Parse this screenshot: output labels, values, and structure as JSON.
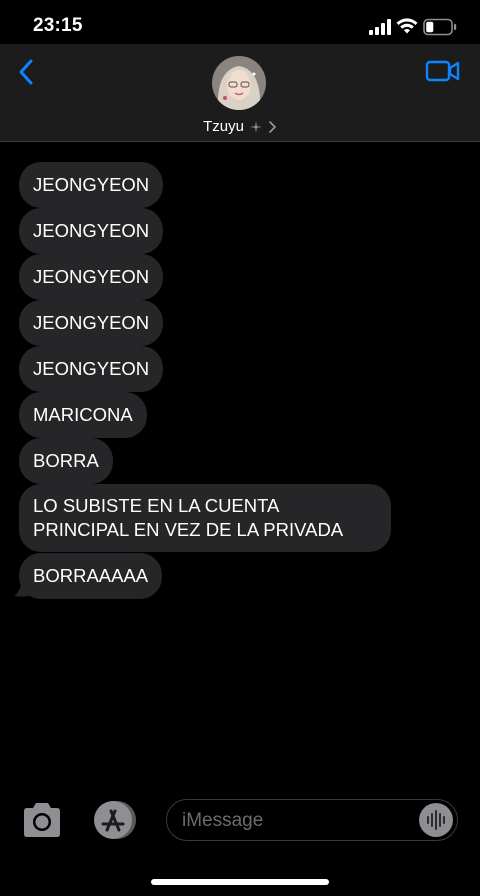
{
  "status_bar": {
    "time": "23:15",
    "battery_level": 0.3
  },
  "header": {
    "contact_name": "Tzuyu",
    "back_icon": "chevron-left-icon",
    "video_icon": "video-camera-icon"
  },
  "messages": [
    {
      "text": "JEONGYEON"
    },
    {
      "text": "JEONGYEON"
    },
    {
      "text": "JEONGYEON"
    },
    {
      "text": "JEONGYEON"
    },
    {
      "text": "JEONGYEON"
    },
    {
      "text": "MARICONA"
    },
    {
      "text": "BORRA"
    },
    {
      "text": "LO SUBISTE EN LA CUENTA PRINCIPAL EN VEZ DE LA PRIVADA"
    },
    {
      "text": "BORRAAAAA"
    }
  ],
  "input_bar": {
    "placeholder": "iMessage"
  },
  "colors": {
    "accent": "#0a84ff",
    "bubble": "#262628",
    "header": "#1c1c1d"
  }
}
